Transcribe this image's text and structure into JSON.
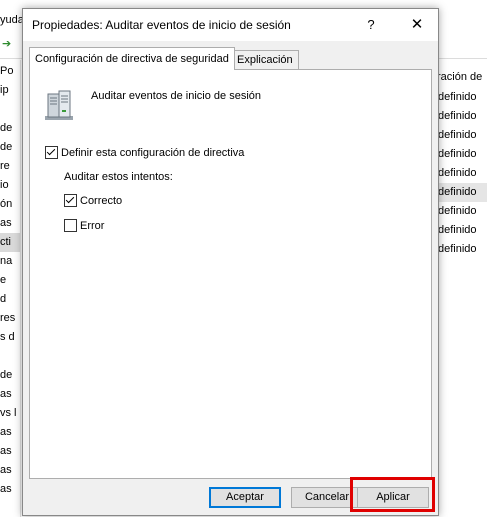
{
  "background": {
    "menu_fragment": "yuda",
    "tree_fragments": [
      "Po",
      "ip",
      "",
      "de",
      "de",
      "re",
      "io",
      "ón",
      "as",
      "cti",
      "na",
      "e",
      "d",
      "res",
      "s d",
      "",
      "de",
      "as",
      "vs l",
      "as",
      "as",
      "as",
      "as"
    ],
    "tree_selected_index": 9,
    "right_header": "ración de",
    "right_items": [
      "definido",
      "definido",
      "definido",
      "definido",
      "definido",
      "definido",
      "definido",
      "definido",
      "definido"
    ],
    "right_selected_index": 5
  },
  "dialog": {
    "title": "Propiedades: Auditar eventos de inicio de sesión",
    "help_glyph": "?",
    "close_glyph": "✕",
    "tabs": [
      {
        "label": "Configuración de directiva de seguridad",
        "active": true
      },
      {
        "label": "Explicación",
        "active": false
      }
    ],
    "policy_name": "Auditar eventos de inicio de sesión",
    "define_checkbox": {
      "label": "Definir esta configuración de directiva",
      "checked": true
    },
    "attempts_label": "Auditar estos intentos:",
    "success_checkbox": {
      "label": "Correcto",
      "checked": true
    },
    "error_checkbox": {
      "label": "Error",
      "checked": false
    },
    "buttons": {
      "accept": "Aceptar",
      "cancel": "Cancelar",
      "apply": "Aplicar"
    },
    "highlight_color": "#e00000"
  }
}
